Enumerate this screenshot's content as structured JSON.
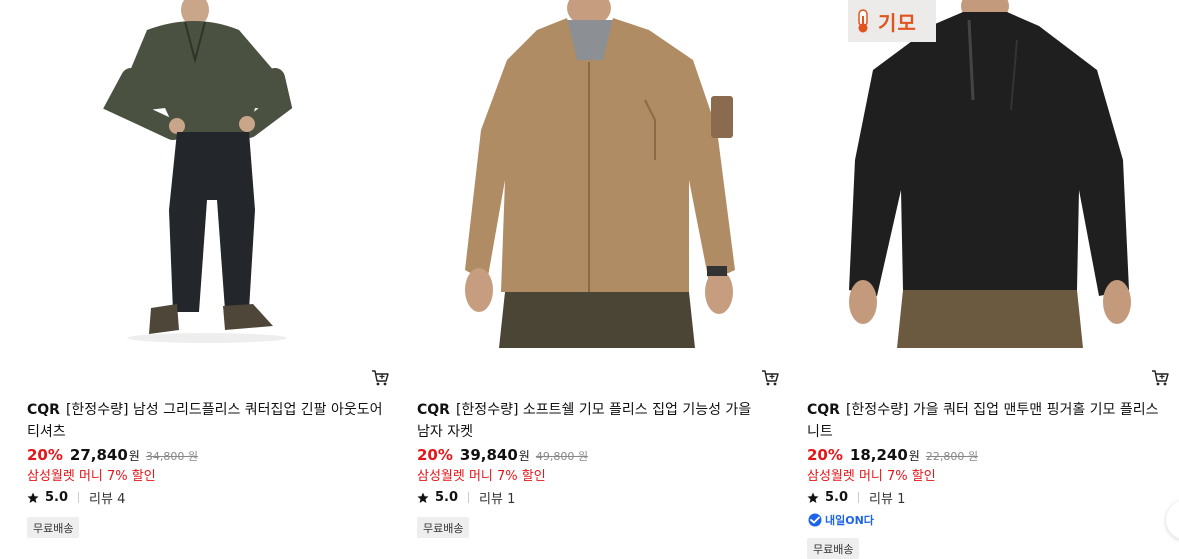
{
  "products": [
    {
      "brand": "CQR",
      "title": "[한정수량] 남성 그리드플리스 쿼터집업 긴팔 아웃도어 티셔츠",
      "discount": "20%",
      "price": "27,840",
      "currency": "원",
      "original_price": "34,800 원",
      "promo": "삼성월렛 머니 7% 할인",
      "rating": "5.0",
      "review": "리뷰 4",
      "shipping": "무료배송",
      "image_desc": "olive quarter-zip fleece with black pants",
      "colors": {
        "top": "#4a5140",
        "pants": "#23262a"
      }
    },
    {
      "brand": "CQR",
      "title": "[한정수량] 소프트쉘 기모 플리스 집업 기능성 가을 남자 자켓",
      "discount": "20%",
      "price": "39,840",
      "currency": "원",
      "original_price": "49,800 원",
      "promo": "삼성월렛 머니 7% 할인",
      "rating": "5.0",
      "review": "리뷰 1",
      "shipping": "무료배송",
      "image_desc": "tan softshell jacket",
      "colors": {
        "top": "#b08c64",
        "pants": "#4b4536"
      }
    },
    {
      "brand": "CQR",
      "title": "[한정수량] 가을 쿼터 집업 맨투맨 핑거홀 기모 플리스 니트",
      "discount": "20%",
      "price": "18,240",
      "currency": "원",
      "original_price": "22,800 원",
      "promo": "삼성월렛 머니 7% 할인",
      "rating": "5.0",
      "review": "리뷰 1",
      "shipping": "무료배송",
      "badge": "기모",
      "next_day": "내일ON다",
      "image_desc": "black quarter-zip fleece knit",
      "colors": {
        "top": "#1f1f1f",
        "pants": "#6b5a40"
      }
    }
  ],
  "icons": {
    "cart": "cart-icon",
    "star": "star-icon",
    "thermometer": "thermometer-icon",
    "next_day": "next-day-delivery-icon"
  },
  "theme": {
    "accent_red": "#e4161a",
    "badge_orange": "#e0541d",
    "next_day_blue": "#1d64e8"
  }
}
